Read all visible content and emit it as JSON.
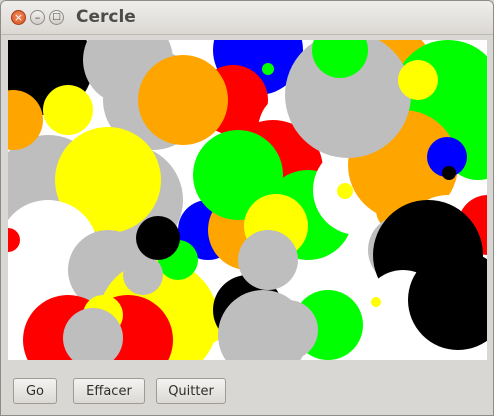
{
  "window": {
    "title": "Cercle",
    "controls": {
      "close_icon": "close-icon",
      "minimize_icon": "minimize-icon",
      "maximize_icon": "maximize-icon"
    }
  },
  "canvas": {
    "background": "#ffffff",
    "palette": {
      "black": "#000000",
      "gray": "#bebebe",
      "yellow": "#ffff00",
      "orange": "#ffa500",
      "green": "#00ff00",
      "blue": "#0000ff",
      "red": "#ff0000",
      "white": "#ffffff"
    }
  },
  "buttons": {
    "go_label": "Go",
    "effacer_label": "Effacer",
    "quitter_label": "Quitter"
  }
}
